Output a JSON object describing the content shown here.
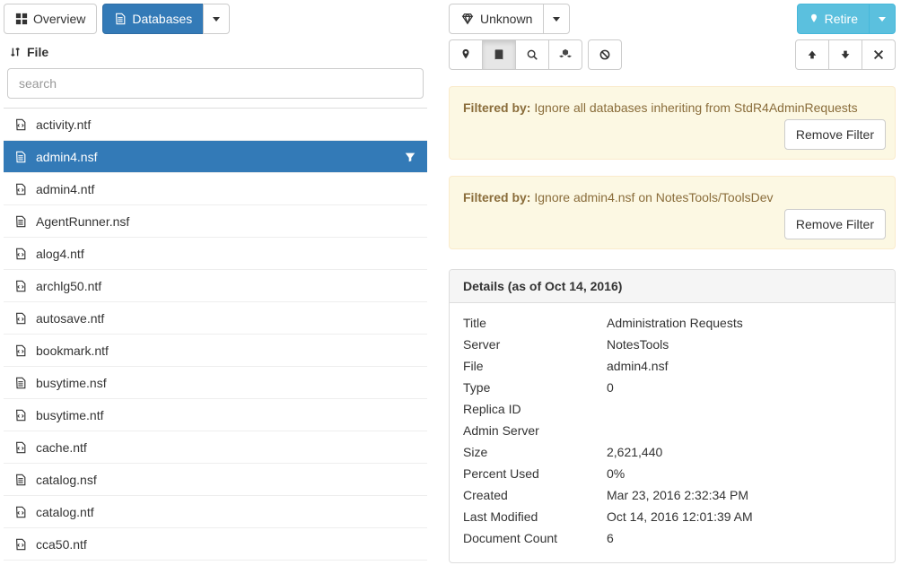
{
  "left": {
    "overview_label": "Overview",
    "databases_label": "Databases",
    "sort_label": "File",
    "search_placeholder": "search",
    "items": [
      {
        "name": "activity.ntf",
        "icon": "file-code"
      },
      {
        "name": "admin4.nsf",
        "icon": "file-text",
        "selected": true,
        "filtered": true
      },
      {
        "name": "admin4.ntf",
        "icon": "file-code"
      },
      {
        "name": "AgentRunner.nsf",
        "icon": "file-text"
      },
      {
        "name": "alog4.ntf",
        "icon": "file-code"
      },
      {
        "name": "archlg50.ntf",
        "icon": "file-code"
      },
      {
        "name": "autosave.ntf",
        "icon": "file-code"
      },
      {
        "name": "bookmark.ntf",
        "icon": "file-code"
      },
      {
        "name": "busytime.nsf",
        "icon": "file-text"
      },
      {
        "name": "busytime.ntf",
        "icon": "file-code"
      },
      {
        "name": "cache.ntf",
        "icon": "file-code"
      },
      {
        "name": "catalog.nsf",
        "icon": "file-text"
      },
      {
        "name": "catalog.ntf",
        "icon": "file-code"
      },
      {
        "name": "cca50.ntf",
        "icon": "file-code"
      }
    ]
  },
  "right": {
    "unknown_label": "Unknown",
    "retire_label": "Retire",
    "filters": [
      {
        "prefix": "Filtered by:",
        "text": "Ignore all databases inheriting from StdR4AdminRequests",
        "remove_label": "Remove Filter"
      },
      {
        "prefix": "Filtered by:",
        "text": "Ignore admin4.nsf on NotesTools/ToolsDev",
        "remove_label": "Remove Filter"
      }
    ],
    "details_heading": "Details (as of Oct 14, 2016)",
    "details": [
      {
        "k": "Title",
        "v": "Administration Requests"
      },
      {
        "k": "Server",
        "v": "NotesTools"
      },
      {
        "k": "File",
        "v": "admin4.nsf"
      },
      {
        "k": "Type",
        "v": "0"
      },
      {
        "k": "Replica ID",
        "v": ""
      },
      {
        "k": "Admin Server",
        "v": ""
      },
      {
        "k": "Size",
        "v": "2,621,440"
      },
      {
        "k": "Percent Used",
        "v": "0%"
      },
      {
        "k": "Created",
        "v": "Mar 23, 2016 2:32:34 PM"
      },
      {
        "k": "Last Modified",
        "v": "Oct 14, 2016 12:01:39 AM"
      },
      {
        "k": "Document Count",
        "v": "6"
      }
    ]
  }
}
